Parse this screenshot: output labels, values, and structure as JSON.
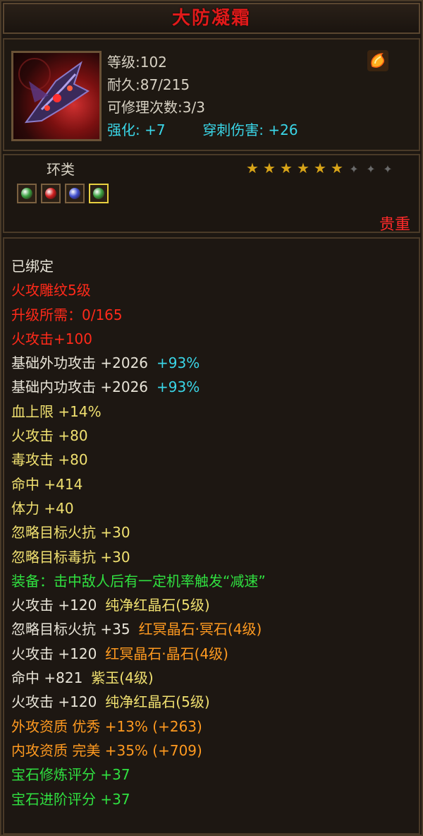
{
  "title": "大防凝霜",
  "stats": {
    "level": "等级:102",
    "durability": "耐久:87/215",
    "repairs": "可修理次数:3/3",
    "enhance_label": "强化:",
    "enhance_value": "+7",
    "pierce_label": "穿刺伤害:",
    "pierce_value": "+26"
  },
  "item_type": "环类",
  "stars": {
    "filled": 6,
    "total": 9
  },
  "gems": [
    {
      "color": "#3aa040",
      "selected": false
    },
    {
      "color": "#d02020",
      "selected": false
    },
    {
      "color": "#4050d0",
      "selected": false
    },
    {
      "color": "#3aa040",
      "selected": true
    }
  ],
  "rarity": "贵重",
  "attributes": [
    {
      "text": "已绑定",
      "color": "w"
    },
    {
      "text": "火攻雕纹5级",
      "color": "red"
    },
    {
      "text": "升级所需：0/165",
      "color": "red"
    },
    {
      "text": "火攻击+100",
      "color": "red"
    },
    {
      "text": "基础外功攻击  +2026",
      "extra": "+93%",
      "color": "w",
      "extra_color": "cyan"
    },
    {
      "text": "基础内功攻击  +2026",
      "extra": "+93%",
      "color": "w",
      "extra_color": "cyan"
    },
    {
      "text": "血上限  +14%",
      "color": "yel"
    },
    {
      "text": "火攻击  +80",
      "color": "yel"
    },
    {
      "text": "毒攻击  +80",
      "color": "yel"
    },
    {
      "text": "命中  +414",
      "color": "yel"
    },
    {
      "text": "体力  +40",
      "color": "yel"
    },
    {
      "text": "忽略目标火抗  +30",
      "color": "yel"
    },
    {
      "text": "忽略目标毒抗  +30",
      "color": "yel"
    },
    {
      "text": "装备：击中敌人后有一定机率触发“减速”",
      "color": "grn"
    },
    {
      "text": "火攻击  +120",
      "extra": "纯净红晶石(5级)",
      "color": "w",
      "extra_color": "yel"
    },
    {
      "text": "忽略目标火抗  +35",
      "extra": "红冥晶石·冥石(4级)",
      "color": "w",
      "extra_color": "org"
    },
    {
      "text": "火攻击  +120",
      "extra": "红冥晶石·晶石(4级)",
      "color": "w",
      "extra_color": "org"
    },
    {
      "text": "命中  +821",
      "extra": "紫玉(4级)",
      "color": "w",
      "extra_color": "yel"
    },
    {
      "text": "火攻击  +120",
      "extra": "纯净红晶石(5级)",
      "color": "w",
      "extra_color": "yel"
    },
    {
      "text": "外攻资质    优秀  +13%  (+263)",
      "color": "org"
    },
    {
      "text": "内攻资质    完美  +35%  (+709)",
      "color": "org"
    },
    {
      "text": "宝石修炼评分  +37",
      "color": "grn"
    },
    {
      "text": "宝石进阶评分  +37",
      "color": "grn"
    }
  ]
}
